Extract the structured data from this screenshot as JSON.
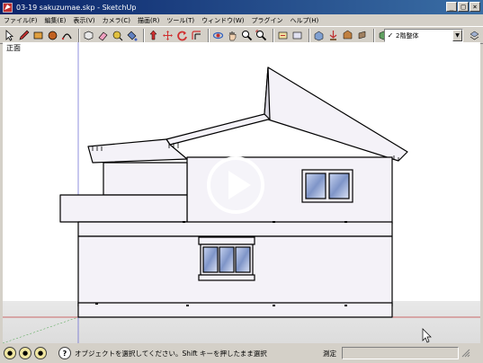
{
  "window": {
    "title": "03-19 sakuzumae.skp - SketchUp",
    "minimize": "_",
    "maximize": "□",
    "close": "×"
  },
  "menu": [
    {
      "id": "file",
      "label": "ファイル(F)"
    },
    {
      "id": "edit",
      "label": "編集(E)"
    },
    {
      "id": "view",
      "label": "表示(V)"
    },
    {
      "id": "camera",
      "label": "カメラ(C)"
    },
    {
      "id": "draw",
      "label": "描画(R)"
    },
    {
      "id": "tools",
      "label": "ツール(T)"
    },
    {
      "id": "window",
      "label": "ウィンドウ(W)"
    },
    {
      "id": "plugins",
      "label": "プラグイン"
    },
    {
      "id": "help",
      "label": "ヘルプ(H)"
    }
  ],
  "layer": {
    "check": "✓",
    "current": "2階整体"
  },
  "viewport": {
    "scene_label": "正面"
  },
  "status": {
    "message": "オブジェクトを選択してください。Shift キーを押したまま選択",
    "measure_label": "測定",
    "measure_value": "",
    "help_glyph": "?"
  },
  "colors": {
    "titlebar": "#0a246a",
    "chrome": "#d4d0c8",
    "wall_fill": "#f4f2f8",
    "glass": "#7f95c8",
    "ground_axis": "#c04040",
    "vertical_axis": "#6060d0"
  }
}
